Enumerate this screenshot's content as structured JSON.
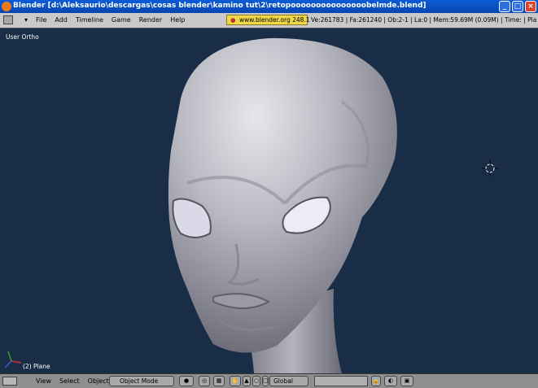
{
  "window": {
    "title": "Blender [d:\\Aleksaurio\\descargas\\cosas blender\\kamino tut\\2\\retopooooooooooooooobelmde.blend]",
    "buttons": {
      "minimize": "_",
      "maximize": "□",
      "close": "×"
    }
  },
  "menubar": {
    "items": [
      "File",
      "Add",
      "Timeline",
      "Game",
      "Render",
      "Help"
    ],
    "url": "www.blender.org",
    "version": "248.1",
    "stats": "Ve:261783 | Fa:261240 | Ob:2-1 | La:0 | Mem:59.69M (0.09M) | Time: | Pla"
  },
  "viewport": {
    "view_label": "User Ortho",
    "object_label": "(2) Plane",
    "colors": {
      "background": "#1a2d47",
      "model": "#b9b9c2"
    }
  },
  "bottombar": {
    "items": [
      "View",
      "Select",
      "Object"
    ],
    "mode": "Object Mode",
    "orientation": "Global"
  },
  "icons": [
    "blender-logo-icon",
    "window-type-icon",
    "axis-icon",
    "3d-cursor-icon",
    "hand-icon",
    "manipulator-icon",
    "layer-grid-icon",
    "lock-icon",
    "render-icon"
  ]
}
